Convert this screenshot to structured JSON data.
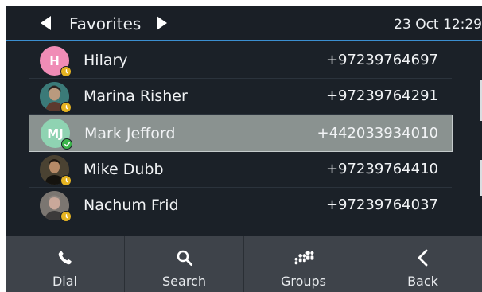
{
  "header": {
    "title": "Favorites",
    "datetime": "23 Oct 12:29"
  },
  "contacts": [
    {
      "initials": "H",
      "name": "Hilary",
      "number": "+97239764697",
      "avatar_color": "#f08cb6",
      "status": "away"
    },
    {
      "initials": "",
      "name": "Marina Risher",
      "number": "+97239764291",
      "avatar_color": "#2f6f73",
      "status": "away"
    },
    {
      "initials": "MJ",
      "name": "Mark Jefford",
      "number": "+442033934010",
      "avatar_color": "#8fd3b2",
      "status": "online",
      "selected": true
    },
    {
      "initials": "",
      "name": "Mike Dubb",
      "number": "+97239764410",
      "avatar_color": "#3a3326",
      "status": "away"
    },
    {
      "initials": "",
      "name": "Nachum Frid",
      "number": "+97239764037",
      "avatar_color": "#6f6a66",
      "status": "away"
    }
  ],
  "softkeys": [
    {
      "label": "Dial",
      "icon": "phone-icon"
    },
    {
      "label": "Search",
      "icon": "search-icon"
    },
    {
      "label": "Groups",
      "icon": "groups-icon"
    },
    {
      "label": "Back",
      "icon": "back-icon"
    }
  ],
  "colors": {
    "accent": "#3b8fd0",
    "away": "#e5b321",
    "online": "#3bb54a"
  }
}
